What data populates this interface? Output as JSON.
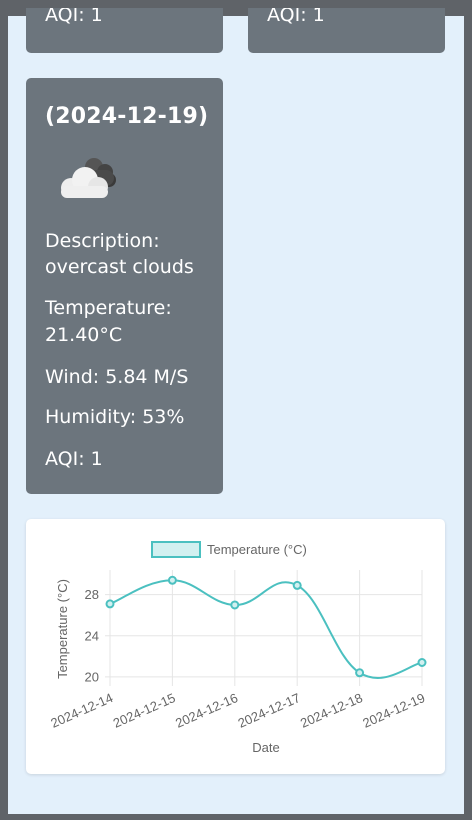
{
  "cards_top": [
    {
      "aqi": "AQI: 1"
    },
    {
      "aqi": "AQI: 1"
    }
  ],
  "forecast_card": {
    "date": "(2024-12-19)",
    "icon": "overcast-clouds-icon",
    "description_label": "Description:",
    "description_value": "overcast clouds",
    "temperature_label": "Temperature:",
    "temperature_value": "21.40°C",
    "wind": "Wind: 5.84 M/S",
    "humidity": "Humidity: 53%",
    "aqi": "AQI: 1"
  },
  "colors": {
    "card_bg": "#6c757d",
    "page_bg": "#e3f0fb",
    "line": "#4bc0c0",
    "legend_fill": "#d2f0f0"
  },
  "chart_data": {
    "type": "line",
    "x": [
      "2024-12-14",
      "2024-12-15",
      "2024-12-16",
      "2024-12-17",
      "2024-12-18",
      "2024-12-19"
    ],
    "series": [
      {
        "name": "Temperature (°C)",
        "values": [
          27.1,
          29.4,
          27.0,
          28.9,
          20.4,
          21.4
        ]
      }
    ],
    "xlabel": "Date",
    "ylabel": "Temperature (°C)",
    "yticks": [
      20,
      24,
      28
    ],
    "ylim": [
      19.6,
      30.4
    ],
    "grid": true,
    "legend": "top",
    "smooth": true
  }
}
